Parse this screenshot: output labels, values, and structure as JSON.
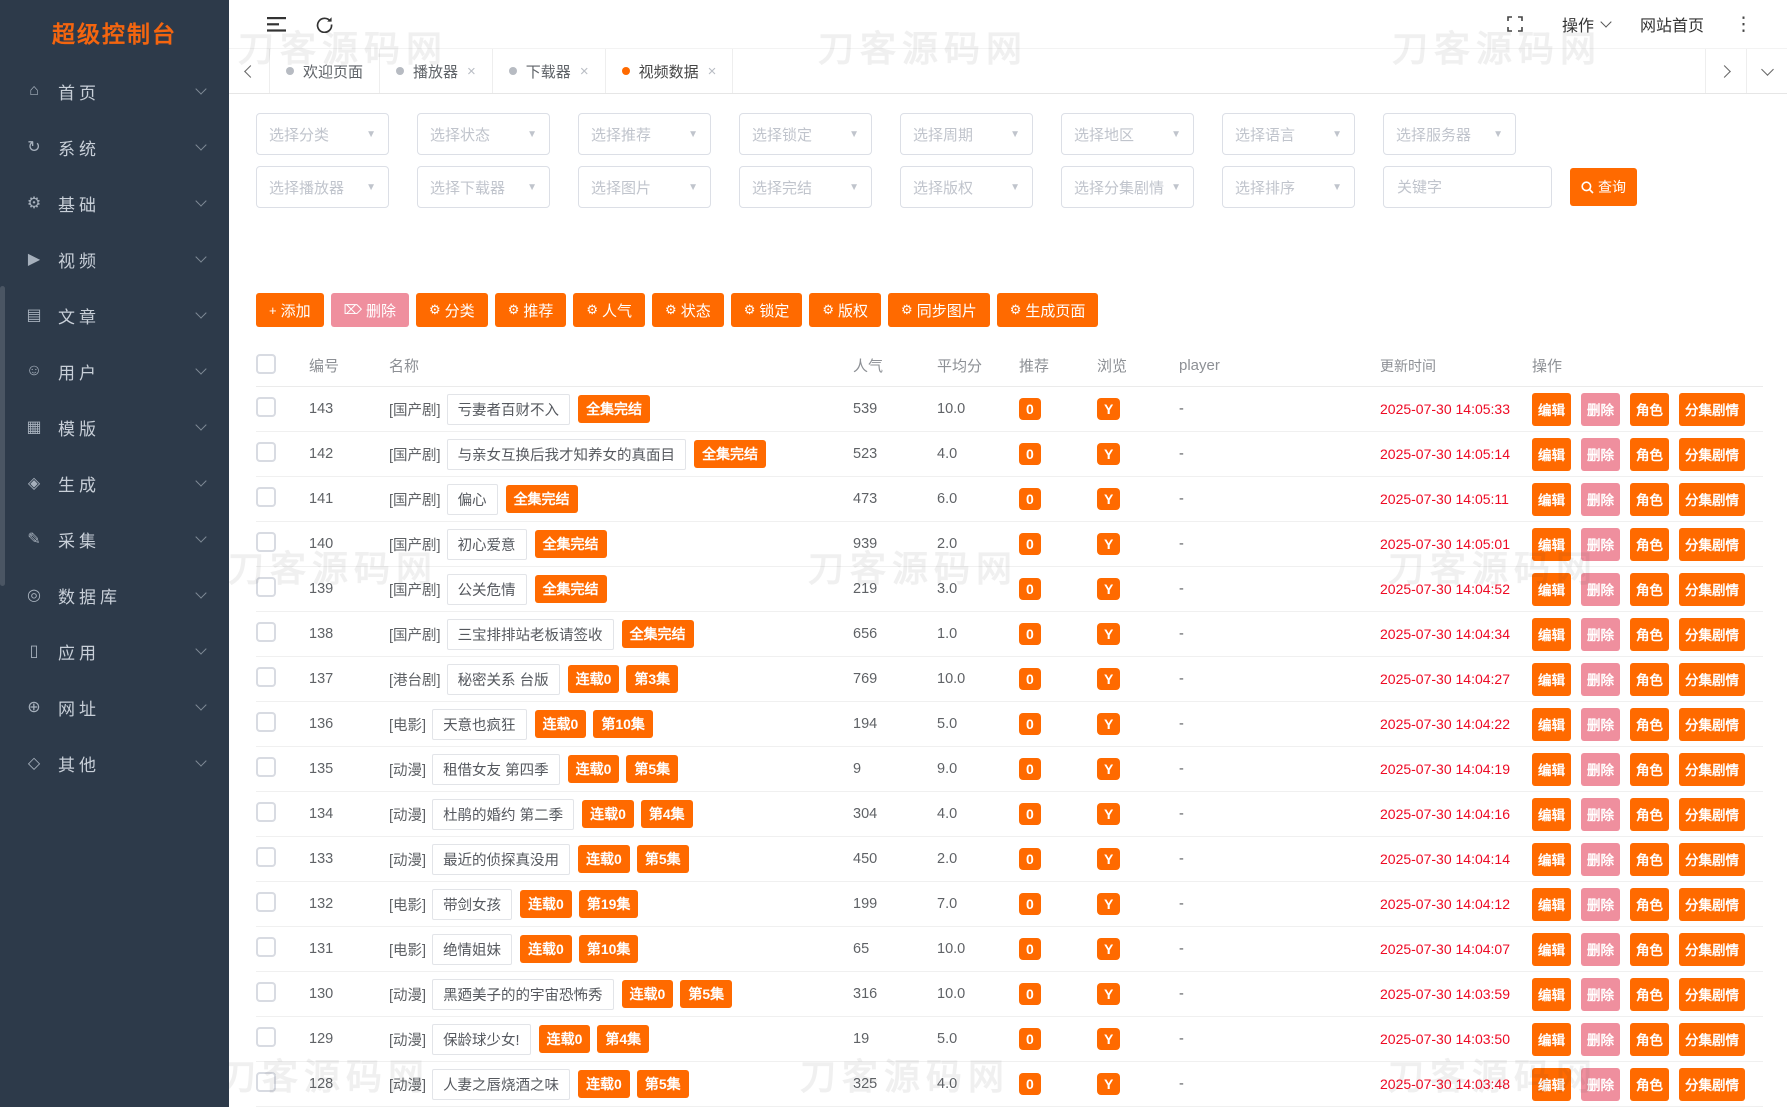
{
  "app_title": "超级控制台",
  "watermark": "刀客源码网",
  "colors": {
    "accent": "#ff6a00",
    "danger_pink": "#ef8f9e",
    "time_red": "#ee0a24",
    "sidebar_bg": "#2d3a4a"
  },
  "sidebar": {
    "items": [
      {
        "icon": "⌂",
        "icon_name": "home-icon",
        "label": "首页"
      },
      {
        "icon": "↻",
        "icon_name": "system-icon",
        "label": "系统"
      },
      {
        "icon": "⚙",
        "icon_name": "settings-gear-icon",
        "label": "基础"
      },
      {
        "icon": "▶",
        "icon_name": "video-icon",
        "label": "视频"
      },
      {
        "icon": "▤",
        "icon_name": "article-icon",
        "label": "文章"
      },
      {
        "icon": "☺",
        "icon_name": "user-icon",
        "label": "用户"
      },
      {
        "icon": "▦",
        "icon_name": "template-icon",
        "label": "模版"
      },
      {
        "icon": "◈",
        "icon_name": "generate-icon",
        "label": "生成"
      },
      {
        "icon": "✎",
        "icon_name": "collect-icon",
        "label": "采集"
      },
      {
        "icon": "◎",
        "icon_name": "database-icon",
        "label": "数据库"
      },
      {
        "icon": "▯",
        "icon_name": "app-icon",
        "label": "应用"
      },
      {
        "icon": "⊕",
        "icon_name": "website-icon",
        "label": "网址"
      },
      {
        "icon": "◇",
        "icon_name": "other-icon",
        "label": "其他"
      }
    ]
  },
  "topbar": {
    "actions_label": "操作",
    "site_home_label": "网站首页"
  },
  "tabbar": {
    "tabs": [
      {
        "label": "欢迎页面",
        "state": "",
        "close": ""
      },
      {
        "label": "播放器",
        "state": "",
        "close": "×"
      },
      {
        "label": "下载器",
        "state": "",
        "close": "×"
      },
      {
        "label": "视频数据",
        "state": "active",
        "close": "×"
      }
    ]
  },
  "filters": {
    "row1": [
      "选择分类",
      "选择状态",
      "选择推荐",
      "选择锁定",
      "选择周期",
      "选择地区",
      "选择语言",
      "选择服务器"
    ],
    "row2": [
      "选择播放器",
      "选择下载器",
      "选择图片",
      "选择完结",
      "选择版权",
      "选择分集剧情",
      "选择排序"
    ],
    "keyword_placeholder": "关键字",
    "search_label": "查询"
  },
  "toolbar": {
    "buttons": [
      {
        "icon": "+",
        "icon_name": "plus-icon",
        "label": "添加",
        "variant": ""
      },
      {
        "icon": "⌦",
        "icon_name": "trash-icon",
        "label": "删除",
        "variant": "pink"
      },
      {
        "icon": "⚙",
        "icon_name": "gear-icon",
        "label": "分类",
        "variant": ""
      },
      {
        "icon": "⚙",
        "icon_name": "gear-icon",
        "label": "推荐",
        "variant": ""
      },
      {
        "icon": "⚙",
        "icon_name": "gear-icon",
        "label": "人气",
        "variant": ""
      },
      {
        "icon": "⚙",
        "icon_name": "gear-icon",
        "label": "状态",
        "variant": ""
      },
      {
        "icon": "⚙",
        "icon_name": "gear-icon",
        "label": "锁定",
        "variant": ""
      },
      {
        "icon": "⚙",
        "icon_name": "gear-icon",
        "label": "版权",
        "variant": ""
      },
      {
        "icon": "⚙",
        "icon_name": "gear-icon",
        "label": "同步图片",
        "variant": ""
      },
      {
        "icon": "⚙",
        "icon_name": "gear-icon",
        "label": "生成页面",
        "variant": ""
      }
    ]
  },
  "table": {
    "headers": {
      "id": "编号",
      "name": "名称",
      "hits": "人气",
      "score": "平均分",
      "recommend": "推荐",
      "view": "浏览",
      "player": "player",
      "updated": "更新时间",
      "actions": "操作"
    },
    "action_labels": {
      "edit": "编辑",
      "del": "删除",
      "role": "角色",
      "episodes": "分集剧情"
    },
    "rows": [
      {
        "id": "143",
        "category": "[国产剧]",
        "title": "亏妻者百财不入",
        "badges": [
          "全集完结"
        ],
        "hits": "539",
        "score": "10.0",
        "recommend": "0",
        "view": "Y",
        "player": "-",
        "updated": "2025-07-30 14:05:33"
      },
      {
        "id": "142",
        "category": "[国产剧]",
        "title": "与亲女互换后我才知养女的真面目",
        "badges": [
          "全集完结"
        ],
        "hits": "523",
        "score": "4.0",
        "recommend": "0",
        "view": "Y",
        "player": "-",
        "updated": "2025-07-30 14:05:14"
      },
      {
        "id": "141",
        "category": "[国产剧]",
        "title": "偏心",
        "badges": [
          "全集完结"
        ],
        "hits": "473",
        "score": "6.0",
        "recommend": "0",
        "view": "Y",
        "player": "-",
        "updated": "2025-07-30 14:05:11"
      },
      {
        "id": "140",
        "category": "[国产剧]",
        "title": "初心爱意",
        "badges": [
          "全集完结"
        ],
        "hits": "939",
        "score": "2.0",
        "recommend": "0",
        "view": "Y",
        "player": "-",
        "updated": "2025-07-30 14:05:01"
      },
      {
        "id": "139",
        "category": "[国产剧]",
        "title": "公关危情",
        "badges": [
          "全集完结"
        ],
        "hits": "219",
        "score": "3.0",
        "recommend": "0",
        "view": "Y",
        "player": "-",
        "updated": "2025-07-30 14:04:52"
      },
      {
        "id": "138",
        "category": "[国产剧]",
        "title": "三宝排排站老板请签收",
        "badges": [
          "全集完结"
        ],
        "hits": "656",
        "score": "1.0",
        "recommend": "0",
        "view": "Y",
        "player": "-",
        "updated": "2025-07-30 14:04:34"
      },
      {
        "id": "137",
        "category": "[港台剧]",
        "title": "秘密关系 台版",
        "badges": [
          "连载0",
          "第3集"
        ],
        "hits": "769",
        "score": "10.0",
        "recommend": "0",
        "view": "Y",
        "player": "-",
        "updated": "2025-07-30 14:04:27"
      },
      {
        "id": "136",
        "category": "[电影]",
        "title": "天意也疯狂",
        "badges": [
          "连载0",
          "第10集"
        ],
        "hits": "194",
        "score": "5.0",
        "recommend": "0",
        "view": "Y",
        "player": "-",
        "updated": "2025-07-30 14:04:22"
      },
      {
        "id": "135",
        "category": "[动漫]",
        "title": "租借女友 第四季",
        "badges": [
          "连载0",
          "第5集"
        ],
        "hits": "9",
        "score": "9.0",
        "recommend": "0",
        "view": "Y",
        "player": "-",
        "updated": "2025-07-30 14:04:19"
      },
      {
        "id": "134",
        "category": "[动漫]",
        "title": "杜鹃的婚约 第二季",
        "badges": [
          "连载0",
          "第4集"
        ],
        "hits": "304",
        "score": "4.0",
        "recommend": "0",
        "view": "Y",
        "player": "-",
        "updated": "2025-07-30 14:04:16"
      },
      {
        "id": "133",
        "category": "[动漫]",
        "title": "最近的侦探真没用",
        "badges": [
          "连载0",
          "第5集"
        ],
        "hits": "450",
        "score": "2.0",
        "recommend": "0",
        "view": "Y",
        "player": "-",
        "updated": "2025-07-30 14:04:14"
      },
      {
        "id": "132",
        "category": "[电影]",
        "title": "带剑女孩",
        "badges": [
          "连载0",
          "第19集"
        ],
        "hits": "199",
        "score": "7.0",
        "recommend": "0",
        "view": "Y",
        "player": "-",
        "updated": "2025-07-30 14:04:12"
      },
      {
        "id": "131",
        "category": "[电影]",
        "title": "绝情姐妹",
        "badges": [
          "连载0",
          "第10集"
        ],
        "hits": "65",
        "score": "10.0",
        "recommend": "0",
        "view": "Y",
        "player": "-",
        "updated": "2025-07-30 14:04:07"
      },
      {
        "id": "130",
        "category": "[动漫]",
        "title": "黑廼美子的的宇宙恐怖秀",
        "badges": [
          "连载0",
          "第5集"
        ],
        "hits": "316",
        "score": "10.0",
        "recommend": "0",
        "view": "Y",
        "player": "-",
        "updated": "2025-07-30 14:03:59"
      },
      {
        "id": "129",
        "category": "[动漫]",
        "title": "保龄球少女!",
        "badges": [
          "连载0",
          "第4集"
        ],
        "hits": "19",
        "score": "5.0",
        "recommend": "0",
        "view": "Y",
        "player": "-",
        "updated": "2025-07-30 14:03:50"
      },
      {
        "id": "128",
        "category": "[动漫]",
        "title": "人妻之唇烧酒之味",
        "badges": [
          "连载0",
          "第5集"
        ],
        "hits": "325",
        "score": "4.0",
        "recommend": "0",
        "view": "Y",
        "player": "-",
        "updated": "2025-07-30 14:03:48"
      }
    ]
  }
}
